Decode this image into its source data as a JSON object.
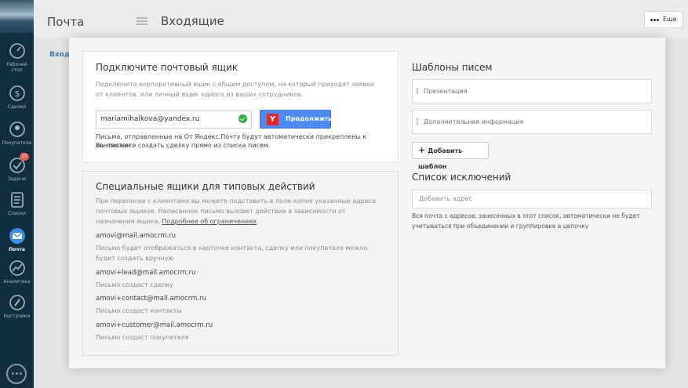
{
  "header": {
    "section": "Почта",
    "title": "Входящие",
    "more_label": "Еще"
  },
  "background": {
    "tab_label": "Входя"
  },
  "sidebar": {
    "items": [
      {
        "label_line1": "Рабочий",
        "label_line2": "стол",
        "icon": "dashboard-icon"
      },
      {
        "label_line1": "Сделки",
        "label_line2": "",
        "icon": "dollar-icon"
      },
      {
        "label_line1": "Покупатели",
        "label_line2": "",
        "icon": "customers-icon"
      },
      {
        "label_line1": "Задачи",
        "label_line2": "",
        "icon": "check-icon",
        "badge": "15"
      },
      {
        "label_line1": "Списки",
        "label_line2": "",
        "icon": "list-icon"
      },
      {
        "label_line1": "Почта",
        "label_line2": "",
        "icon": "mail-icon",
        "active": true
      },
      {
        "label_line1": "Аналитика",
        "label_line2": "",
        "icon": "analytics-icon"
      },
      {
        "label_line1": "Настройки",
        "label_line2": "",
        "icon": "settings-icon"
      }
    ]
  },
  "connect": {
    "title": "Подключите почтовый ящик",
    "description_line1": "Подключите корпоративный ящик с общим доступом, на который приходят заявки",
    "description_line2": "от клиентов, или личный ящик одного из ваших сотрудников.",
    "email_value": "mariamihalkova@yandex.ru",
    "button_icon_letter": "Y",
    "button_label": "Продолжить",
    "note_line1": "Письма, отправленные на От Яндекс.Почту будут автоматически прикреплены к контактам.",
    "note_line2": "Вы сможете создать сделку прямо из списка писем."
  },
  "special": {
    "title": "Специальные ящики для типовых действий",
    "description_line1": "При переписке с клиентами вы можете подставить в поле копия указанные адреса",
    "description_line2": "почтовых ящиков. Написанное письмо вызовет действие в зависимости от",
    "description_line3_prefix": "назначения ящика. ",
    "limits_link": "Подробнее об ограничениях",
    "mailboxes": [
      {
        "address": "amovi@mail.amocrm.ru",
        "desc_line1": "Письмо будет отображаться в карточке контакта, сделку или покупателя можно",
        "desc_line2": "будет создать вручную"
      },
      {
        "address": "amovi+lead@mail.amocrm.ru",
        "desc_line1": "Письмо создаст сделку",
        "desc_line2": ""
      },
      {
        "address": "amovi+contact@mail.amocrm.ru",
        "desc_line1": "Письмо создаст контакты",
        "desc_line2": ""
      },
      {
        "address": "amovi+customer@mail.amocrm.ru",
        "desc_line1": "Письмо создаст покупателя",
        "desc_line2": ""
      }
    ]
  },
  "templates": {
    "title": "Шаблоны писем",
    "items": [
      "Презентация",
      "Дополнительная информация"
    ],
    "add_label": "Добавить шаблон"
  },
  "exclusions": {
    "title": "Список исключений",
    "placeholder": "Добавить адрес",
    "help_line1": "Вся почта с адресов, занесенных в этот список, автоматически не будет",
    "help_line2": "учитываться при объединении и группировке в цепочку"
  },
  "colors": {
    "sidebar": "#16384f",
    "accent_blue": "#4c8bf5",
    "yandex_red": "#e32828",
    "success_green": "#2aae38",
    "badge_red": "#e9584d"
  }
}
